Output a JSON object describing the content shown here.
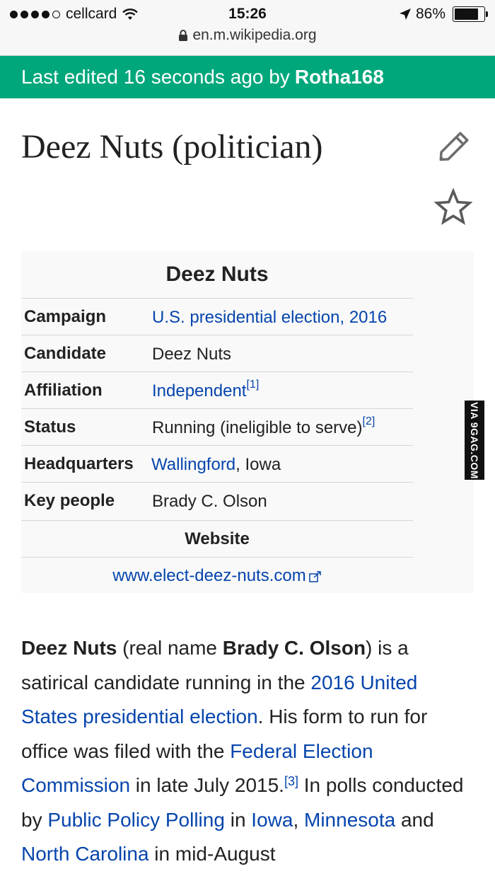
{
  "status_bar": {
    "carrier": "cellcard",
    "time": "15:26",
    "battery": "86%",
    "battery_level": 0.86,
    "url": "en.m.wikipedia.org"
  },
  "banner": {
    "prefix": "Last edited 16 seconds ago by",
    "user": "Rotha168"
  },
  "page_title": "Deez Nuts (politician)",
  "infobox": {
    "title": "Deez Nuts",
    "rows": [
      {
        "label": "Campaign",
        "value": "U.S. presidential election, 2016"
      },
      {
        "label": "Candidate",
        "value": "Deez Nuts"
      },
      {
        "label": "Affiliation",
        "value": "Independent",
        "ref": "[1]"
      },
      {
        "label": "Status",
        "value": "Running (ineligible to serve)",
        "ref": "[2]"
      },
      {
        "label": "Headquarters",
        "value": "Wallingford",
        "value_suffix": ", Iowa"
      },
      {
        "label": "Key people",
        "value": "Brady C. Olson"
      }
    ],
    "website_header": "Website",
    "website_url": "www.elect-deez-nuts.com"
  },
  "watermark": "VIA 9GAG.COM",
  "paragraph": {
    "s1_bold": "Deez Nuts",
    "s2": " (real name ",
    "s3_bold": "Brady C. Olson",
    "s4": ") is a satirical candidate running in the ",
    "link1": "2016 United States presidential election",
    "s5": ". His form to run for office was filed with the ",
    "link2": "Federal Election Commission",
    "s6": " in late July 2015.",
    "ref3": "[3]",
    "s7": " In polls conducted by ",
    "link3": "Public Policy Polling",
    "s8": " in ",
    "link4": "Iowa",
    "s9": ", ",
    "link5": "Minnesota",
    "s10": " and ",
    "link6": "North Carolina",
    "s11": " in mid-August"
  }
}
